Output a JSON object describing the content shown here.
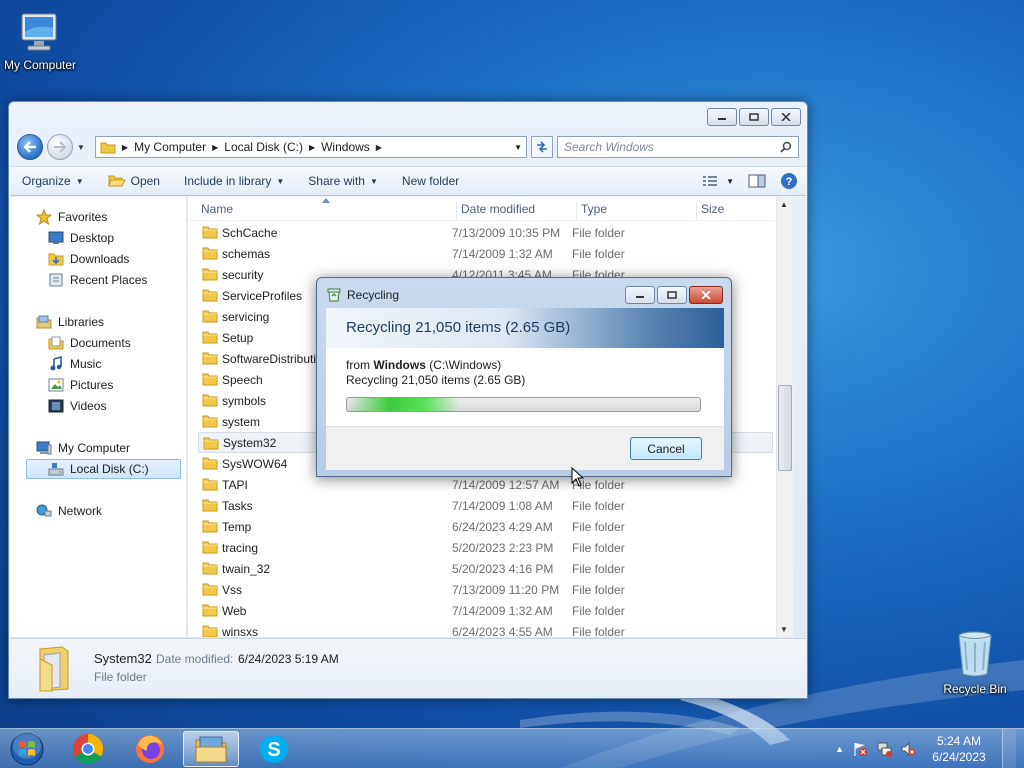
{
  "desktop": {
    "icons": [
      {
        "label": "My Computer",
        "icon": "computer-icon"
      },
      {
        "label": "Recycle Bin",
        "icon": "recycle-bin-icon"
      }
    ]
  },
  "explorer": {
    "address": {
      "crumbs": [
        "My Computer",
        "Local Disk (C:)",
        "Windows"
      ]
    },
    "search_placeholder": "Search Windows",
    "toolbar": {
      "organize": "Organize",
      "open": "Open",
      "include_in_library": "Include in library",
      "share_with": "Share with",
      "new_folder": "New folder"
    },
    "nav": {
      "favorites": "Favorites",
      "desktop": "Desktop",
      "downloads": "Downloads",
      "recent_places": "Recent Places",
      "libraries": "Libraries",
      "documents": "Documents",
      "music": "Music",
      "pictures": "Pictures",
      "videos": "Videos",
      "my_computer": "My Computer",
      "local_disk": "Local Disk (C:)",
      "network": "Network"
    },
    "columns": {
      "name": "Name",
      "date": "Date modified",
      "type": "Type",
      "size": "Size"
    },
    "rows": [
      {
        "name": "SchCache",
        "date": "7/13/2009 10:35 PM",
        "type": "File folder"
      },
      {
        "name": "schemas",
        "date": "7/14/2009 1:32 AM",
        "type": "File folder"
      },
      {
        "name": "security",
        "date": "4/12/2011 3:45 AM",
        "type": "File folder"
      },
      {
        "name": "ServiceProfiles",
        "date": "",
        "type": ""
      },
      {
        "name": "servicing",
        "date": "",
        "type": ""
      },
      {
        "name": "Setup",
        "date": "",
        "type": ""
      },
      {
        "name": "SoftwareDistributio",
        "date": "",
        "type": ""
      },
      {
        "name": "Speech",
        "date": "",
        "type": ""
      },
      {
        "name": "symbols",
        "date": "",
        "type": ""
      },
      {
        "name": "system",
        "date": "",
        "type": ""
      },
      {
        "name": "System32",
        "date": "",
        "type": ""
      },
      {
        "name": "SysWOW64",
        "date": "",
        "type": ""
      },
      {
        "name": "TAPI",
        "date": "7/14/2009 12:57 AM",
        "type": "File folder"
      },
      {
        "name": "Tasks",
        "date": "7/14/2009 1:08 AM",
        "type": "File folder"
      },
      {
        "name": "Temp",
        "date": "6/24/2023 4:29 AM",
        "type": "File folder"
      },
      {
        "name": "tracing",
        "date": "5/20/2023 2:23 PM",
        "type": "File folder"
      },
      {
        "name": "twain_32",
        "date": "5/20/2023 4:16 PM",
        "type": "File folder"
      },
      {
        "name": "Vss",
        "date": "7/13/2009 11:20 PM",
        "type": "File folder"
      },
      {
        "name": "Web",
        "date": "7/14/2009 1:32 AM",
        "type": "File folder"
      },
      {
        "name": "winsxs",
        "date": "6/24/2023 4:55 AM",
        "type": "File folder"
      }
    ],
    "details": {
      "name": "System32",
      "date_label": "Date modified:",
      "date_value": "6/24/2023 5:19 AM",
      "type": "File folder"
    }
  },
  "dialog": {
    "title": "Recycling",
    "header": "Recycling 21,050 items (2.65 GB)",
    "from_prefix": "from",
    "from_name": "Windows",
    "from_path": "(C:\\Windows)",
    "status": "Recycling 21,050 items (2.65 GB)",
    "cancel": "Cancel"
  },
  "taskbar": {
    "apps": [
      "start-orb",
      "chrome-icon",
      "firefox-icon",
      "explorer-icon",
      "skype-icon"
    ],
    "time": "5:24 AM",
    "date": "6/24/2023"
  }
}
